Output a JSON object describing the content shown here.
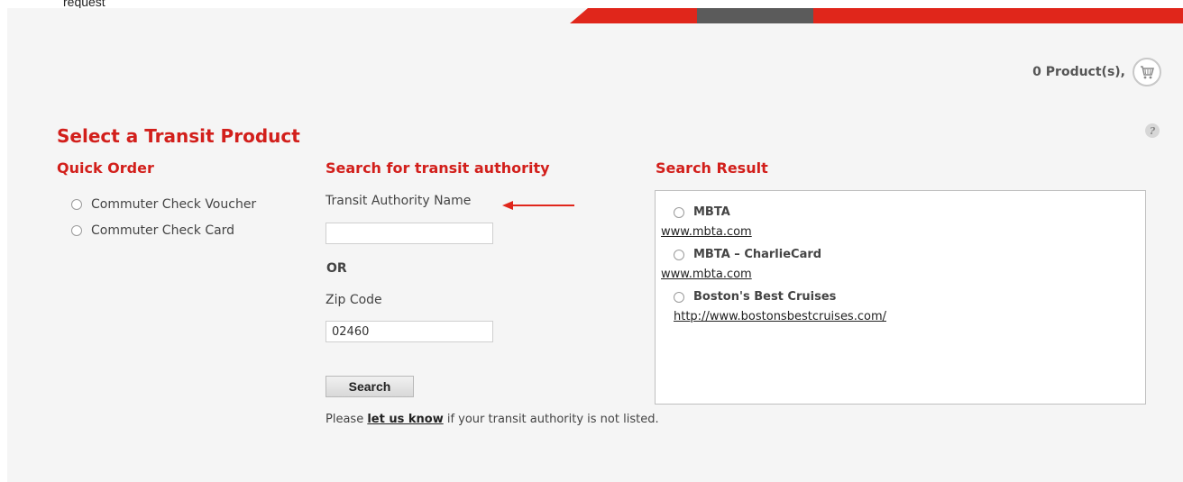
{
  "header": {
    "cut_text": "request"
  },
  "cart": {
    "label": "0 Product(s),",
    "icon": "cart-icon"
  },
  "page": {
    "title": "Select a Transit Product",
    "help_icon": "help-icon"
  },
  "quick_order": {
    "title": "Quick Order",
    "options": [
      {
        "label": "Commuter Check Voucher"
      },
      {
        "label": "Commuter Check Card"
      }
    ]
  },
  "search": {
    "title": "Search for transit authority",
    "authority_label": "Transit Authority Name",
    "authority_value": "",
    "or_label": "OR",
    "zip_label": "Zip Code",
    "zip_value": "02460",
    "button_label": "Search",
    "note_prefix": "Please ",
    "note_link": "let us know",
    "note_suffix": " if your transit authority is not listed."
  },
  "results": {
    "title": "Search Result",
    "items": [
      {
        "name": "MBTA",
        "url": "www.mbta.com"
      },
      {
        "name": "MBTA – CharlieCard",
        "url": "www.mbta.com"
      },
      {
        "name": "Boston's Best Cruises",
        "url": "http://www.bostonsbestcruises.com/"
      }
    ]
  },
  "colors": {
    "accent": "#d21f1b",
    "bar_red": "#e0261b",
    "bar_gray": "#5b5b5b"
  }
}
